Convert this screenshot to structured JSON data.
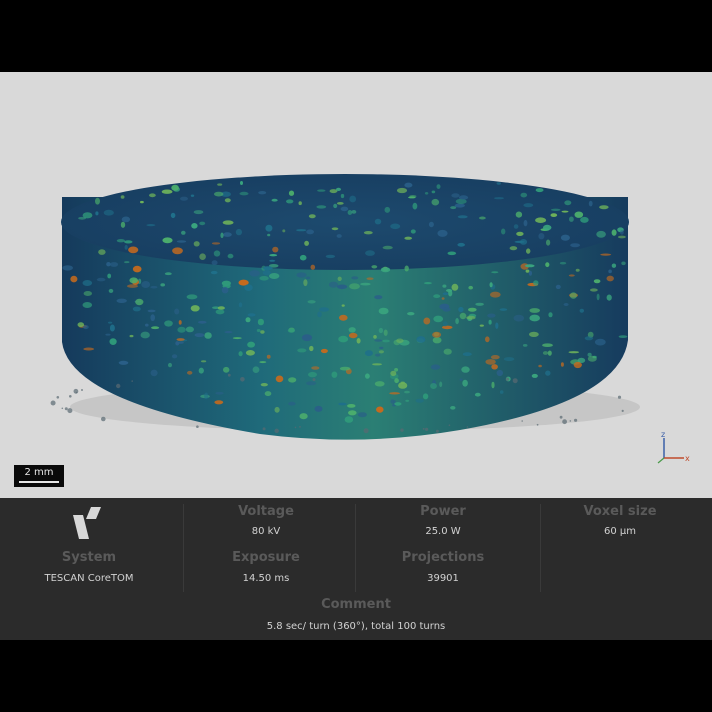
{
  "scale_bar": {
    "label": "2 mm"
  },
  "axes": {
    "z_label": "z",
    "x_label": "x"
  },
  "info": {
    "voltage": {
      "label": "Voltage",
      "value": "80 kV"
    },
    "power": {
      "label": "Power",
      "value": "25.0 W"
    },
    "voxel_size": {
      "label": "Voxel size",
      "value": "60 µm"
    },
    "system": {
      "label": "System",
      "value": "TESCAN CoreTOM"
    },
    "exposure": {
      "label": "Exposure",
      "value": "14.50 ms"
    },
    "projections": {
      "label": "Projections",
      "value": "39901"
    },
    "comment": {
      "label": "Comment",
      "value": "5.8 sec/ turn (360°), total 100 turns"
    }
  },
  "colors": {
    "viewport_bg": "#d9d9d9",
    "panel_bg": "#2b2b2b",
    "sample_blue": "#1f4e73",
    "sample_teal": "#2a8a78",
    "sample_orange": "#c46a1e",
    "axis_z": "#3b5fa8",
    "axis_x": "#c04a2a"
  },
  "icons": {
    "logo": "tescan-logo",
    "axes": "xyz-axes-icon"
  }
}
